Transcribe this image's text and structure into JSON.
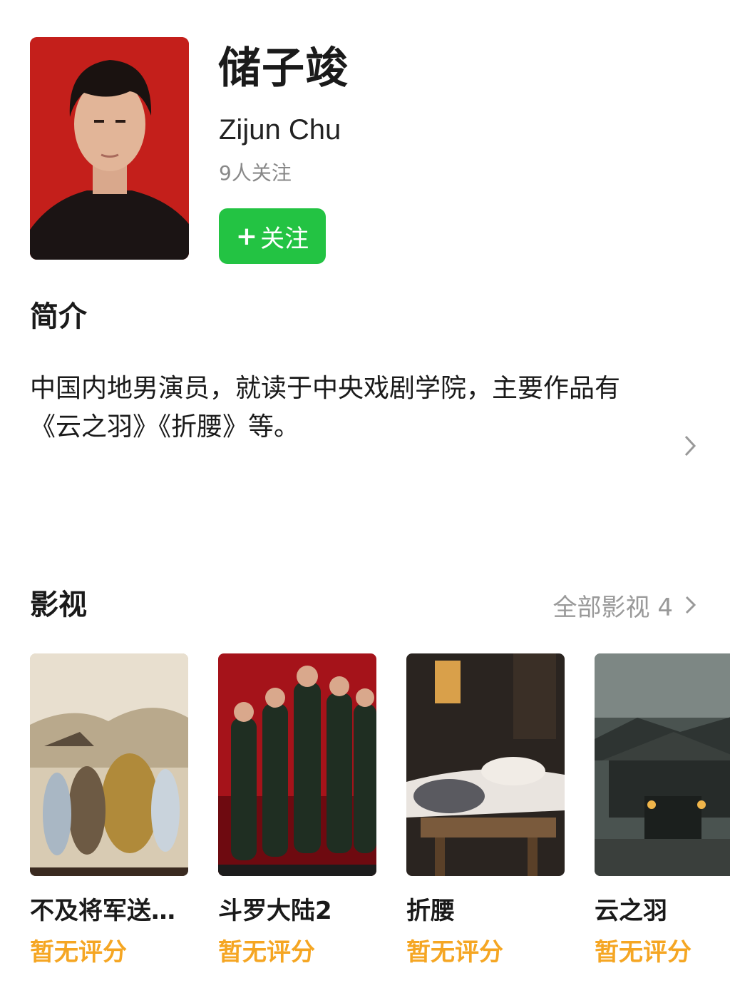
{
  "profile": {
    "name_cn": "储子竣",
    "name_en": "Zijun Chu",
    "followers": "9人关注",
    "follow_button": {
      "icon": "plus-icon",
      "label": "关注"
    }
  },
  "intro": {
    "title": "简介",
    "text": "中国内地男演员，就读于中央戏剧学院，主要作品有《云之羽》《折腰》等。"
  },
  "films": {
    "title": "影视",
    "all_label": "全部影视 4",
    "items": [
      {
        "title": "不及将军送…",
        "rating": "暂无评分"
      },
      {
        "title": "斗罗大陆2",
        "rating": "暂无评分"
      },
      {
        "title": "折腰",
        "rating": "暂无评分"
      },
      {
        "title": "云之羽",
        "rating": "暂无评分"
      }
    ]
  },
  "colors": {
    "accent_green": "#23c343",
    "rating_orange": "#f5a623",
    "muted": "#999999"
  }
}
